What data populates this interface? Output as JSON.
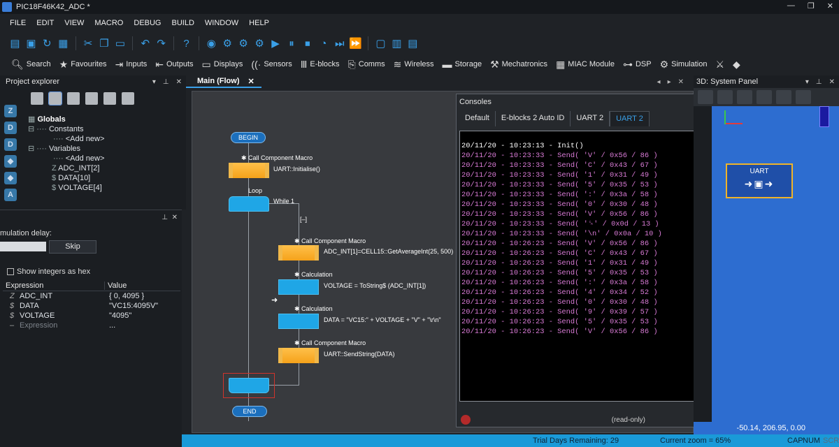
{
  "window": {
    "title": "PIC18F46K42_ADC *",
    "btn_min": "—",
    "btn_restore": "❐",
    "btn_close": "✕"
  },
  "menu": [
    "FILE",
    "EDIT",
    "VIEW",
    "MACRO",
    "DEBUG",
    "BUILD",
    "WINDOW",
    "HELP"
  ],
  "toolbar2": {
    "search": "Search",
    "favourites": "Favourites",
    "inputs": "Inputs",
    "outputs": "Outputs",
    "displays": "Displays",
    "sensors": "Sensors",
    "eblocks": "E-blocks",
    "comms": "Comms",
    "wireless": "Wireless",
    "storage": "Storage",
    "mechatronics": "Mechatronics",
    "miac": "MIAC Module",
    "dsp": "DSP",
    "simulation": "Simulation"
  },
  "project_explorer": {
    "title": "Project explorer",
    "tree": {
      "globals": "Globals",
      "constants": "Constants",
      "add_new_1": "<Add new>",
      "variables": "Variables",
      "add_new_2": "<Add new>",
      "var1": "ADC_INT[2]",
      "var2": "DATA[10]",
      "var3": "VOLTAGE[4]"
    }
  },
  "var_panel": {
    "sim_delay_label": "mulation delay:",
    "skip": "Skip",
    "show_hex": "Show integers as hex",
    "col_expression": "Expression",
    "col_value": "Value",
    "rows": [
      {
        "name": "ADC_INT",
        "value": "{ 0, 4095 }"
      },
      {
        "name": "DATA",
        "value": "\"VC15:4095V\""
      },
      {
        "name": "VOLTAGE",
        "value": "\"4095\""
      },
      {
        "name": "Expression",
        "value": "..."
      }
    ]
  },
  "main_tab": {
    "label": "Main (Flow)",
    "close": "✕"
  },
  "flow": {
    "begin": "BEGIN",
    "end": "END",
    "ccm1": "Call Component Macro",
    "ccm1_text": "UART::Initialise()",
    "loop": "Loop",
    "while": "While 1",
    "collapse": "[–]",
    "ccm2": "Call Component Macro",
    "ccm2_text": "ADC_INT[1]=CELL15::GetAverageInt(25, 500)",
    "calc1": "Calculation",
    "calc1_text": "VOLTAGE = ToString$ (ADC_INT[1])",
    "calc2": "Calculation",
    "calc2_text": "DATA = \"VC15:\" + VOLTAGE + \"V\" + \"\\r\\n\"",
    "ccm3": "Call Component Macro",
    "ccm3_text": "UART::SendString(DATA)"
  },
  "consoles": {
    "title": "Consoles",
    "tabs": [
      "Default",
      "E-blocks 2 Auto ID",
      "UART 2",
      "UART 2"
    ],
    "active_tab": 3,
    "read_only": "(read-only)",
    "lines": [
      "20/11/20 - 10:23:13 - Init()",
      "20/11/20 - 10:23:33 - Send( 'V' / 0x56 / 86 )",
      "20/11/20 - 10:23:33 - Send( 'C' / 0x43 / 67 )",
      "20/11/20 - 10:23:33 - Send( '1' / 0x31 / 49 )",
      "20/11/20 - 10:23:33 - Send( '5' / 0x35 / 53 )",
      "20/11/20 - 10:23:33 - Send( ':' / 0x3a / 58 )",
      "20/11/20 - 10:23:33 - Send( '0' / 0x30 / 48 )",
      "20/11/20 - 10:23:33 - Send( 'V' / 0x56 / 86 )",
      "20/11/20 - 10:23:33 - Send( '␍' / 0x0d / 13 )",
      "20/11/20 - 10:23:33 - Send( '\\n' / 0x0a / 10 )",
      "20/11/20 - 10:26:23 - Send( 'V' / 0x56 / 86 )",
      "20/11/20 - 10:26:23 - Send( 'C' / 0x43 / 67 )",
      "20/11/20 - 10:26:23 - Send( '1' / 0x31 / 49 )",
      "20/11/20 - 10:26:23 - Send( '5' / 0x35 / 53 )",
      "20/11/20 - 10:26:23 - Send( ':' / 0x3a / 58 )",
      "20/11/20 - 10:26:23 - Send( '4' / 0x34 / 52 )",
      "20/11/20 - 10:26:23 - Send( '0' / 0x30 / 48 )",
      "20/11/20 - 10:26:23 - Send( '9' / 0x39 / 57 )",
      "20/11/20 - 10:26:23 - Send( '5' / 0x35 / 53 )",
      "20/11/20 - 10:26:23 - Send( 'V' / 0x56 / 86 )"
    ]
  },
  "system_panel": {
    "title": "3D: System Panel",
    "uart_label": "UART",
    "coords": "-50.14, 206.95, 0.00"
  },
  "status": {
    "trial": "Trial Days Remaining: 29",
    "zoom": "Current zoom = 65%",
    "cap": "CAP",
    "num": "NUM",
    "scr": "SCR"
  }
}
